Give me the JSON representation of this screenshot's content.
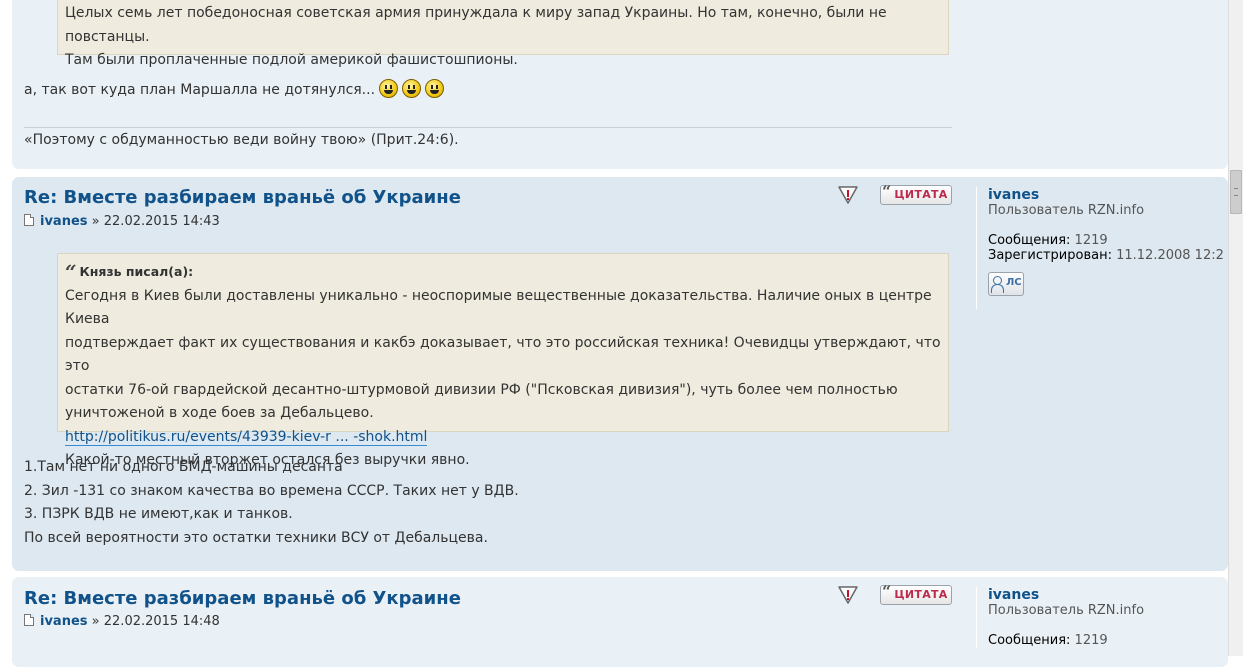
{
  "post_prev": {
    "quote_lines": [
      "Целых семь лет победоносная советская армия принуждала к миру запад Украины. Но там, конечно, были не повстанцы.",
      "Там были проплаченные подлой америкой фашистошпионы."
    ],
    "reply": "а, так вот куда план Маршалла не дотянулся...",
    "signature": "«Поэтому с обдуманностью веди войну твою» (Прит.24:6)."
  },
  "post1": {
    "title": "Re: Вместе разбираем враньё об Украине",
    "author": "ivanes",
    "separator": "»",
    "datetime": "22.02.2015 14:43",
    "quote_button": "ЦИТАТА",
    "quote": {
      "cite": "Князь писал(а):",
      "lines": [
        "Сегодня в Киев были доставлены уникально - неоспоримые вещественные доказательства. Наличие оных в центре Киева",
        "подтверждает факт их существования и какбэ доказывает, что это российская техника! Очевидцы утверждают, что это",
        "остатки 76-ой гвардейской десантно-штурмовой дивизии РФ (\"Псковская дивизия\"), чуть более чем полностью",
        "уничтоженой в ходе боев за Дебальцево."
      ],
      "link": "http://politikus.ru/events/43939-kiev-r ... -shok.html",
      "after": "Какой-то местный вторжет остался без выручки явно."
    },
    "body_lines": [
      "1.Там нет ни одного БМД-машины десанта",
      "2. Зил -131 со знаком качества во времена СССР. Таких нет у ВДВ.",
      "3. ПЗРК ВДВ не имеют,как и танков.",
      "По всей вероятности это остатки техники ВСУ от Дебальцева."
    ],
    "profile": {
      "name": "ivanes",
      "rank": "Пользователь RZN.info",
      "posts_label": "Сообщения:",
      "posts_value": "1219",
      "reg_label": "Зарегистрирован:",
      "reg_value": "11.12.2008 12:2",
      "pm_label": "ЛС"
    }
  },
  "post2": {
    "title": "Re: Вместе разбираем враньё об Украине",
    "author": "ivanes",
    "separator": "»",
    "datetime": "22.02.2015 14:48",
    "quote_button": "ЦИТАТА",
    "profile": {
      "name": "ivanes",
      "rank": "Пользователь RZN.info",
      "posts_label": "Сообщения:",
      "posts_value": "1219"
    }
  }
}
